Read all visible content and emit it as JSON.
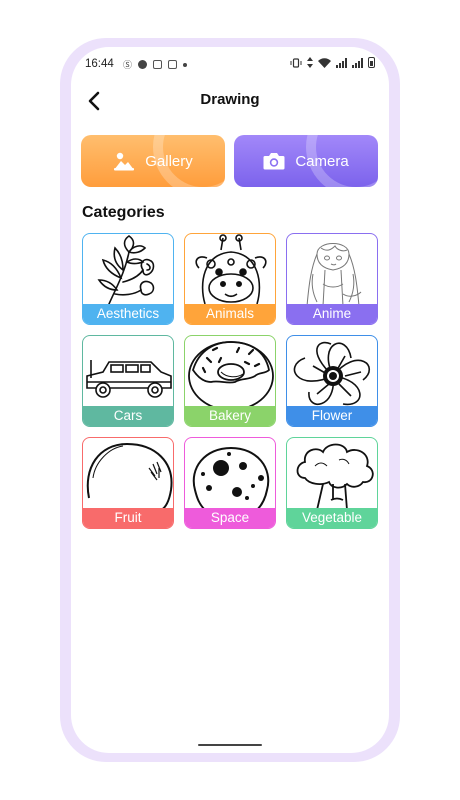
{
  "status_bar": {
    "time": "16:44",
    "left_icons": [
      "sim-icon",
      "play-icon",
      "notification-box-icon",
      "notification-box-icon",
      "dot-icon"
    ],
    "right_icons": [
      "vibrate-icon",
      "data-arrows-icon",
      "wifi-icon",
      "signal-icon",
      "signal-icon",
      "battery-icon"
    ]
  },
  "header": {
    "back_icon": "back-arrow-icon",
    "title": "Drawing"
  },
  "actions": {
    "gallery": {
      "label": "Gallery",
      "icon": "image-icon",
      "color": "#FFA848"
    },
    "camera": {
      "label": "Camera",
      "icon": "camera-icon",
      "color": "#8B72F2"
    }
  },
  "categories_title": "Categories",
  "categories": [
    {
      "label": "Aesthetics",
      "color": "#4FB3F0",
      "art": "flower-branch"
    },
    {
      "label": "Animals",
      "color": "#FFA43A",
      "art": "giraffe"
    },
    {
      "label": "Anime",
      "color": "#8A6FF0",
      "art": "anime-girl"
    },
    {
      "label": "Cars",
      "color": "#5FB8A0",
      "art": "car"
    },
    {
      "label": "Bakery",
      "color": "#8BD36A",
      "art": "donut"
    },
    {
      "label": "Flower",
      "color": "#3F8FE8",
      "art": "flower"
    },
    {
      "label": "Fruit",
      "color": "#F86B6B",
      "art": "fruit"
    },
    {
      "label": "Space",
      "color": "#EE5BDB",
      "art": "moon"
    },
    {
      "label": "Vegetable",
      "color": "#5FD49A",
      "art": "broccoli"
    }
  ]
}
